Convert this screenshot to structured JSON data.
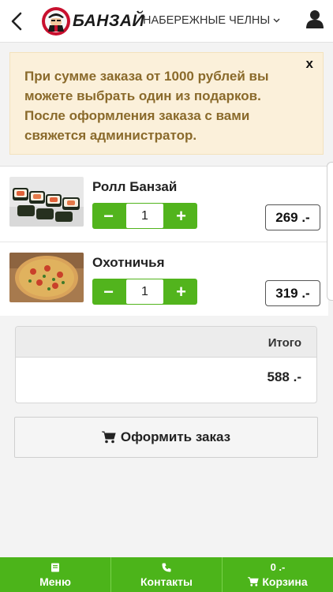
{
  "header": {
    "brand": "БАНЗАЙ",
    "city": "НАБЕРЕЖНЫЕ ЧЕЛНЫ",
    "city_caret": "⌄"
  },
  "notice": {
    "text": "При сумме заказа от 1000 рублей вы можете выбрать один из подарков. После оформления заказа с вами свяжется администратор.",
    "close": "x"
  },
  "cart": {
    "items": [
      {
        "name": "Ролл Банзай",
        "qty": "1",
        "price": "269 .-"
      },
      {
        "name": "Охотничья",
        "qty": "1",
        "price": "319 .-"
      }
    ],
    "minus": "−",
    "plus": "+"
  },
  "total": {
    "label": "Итого",
    "value": "588 .-"
  },
  "checkout": {
    "label": "Оформить заказ"
  },
  "nav": {
    "menu": "Меню",
    "contacts": "Контакты",
    "cart_amount": "0 .-",
    "cart": "Корзина"
  },
  "colors": {
    "green": "#4cb41a",
    "notice_bg": "#fbf0da",
    "notice_text": "#8a6a2b"
  },
  "icons": [
    "back-arrow-icon",
    "samurai-logo-icon",
    "user-icon",
    "cart-icon",
    "book-icon",
    "phone-icon"
  ]
}
